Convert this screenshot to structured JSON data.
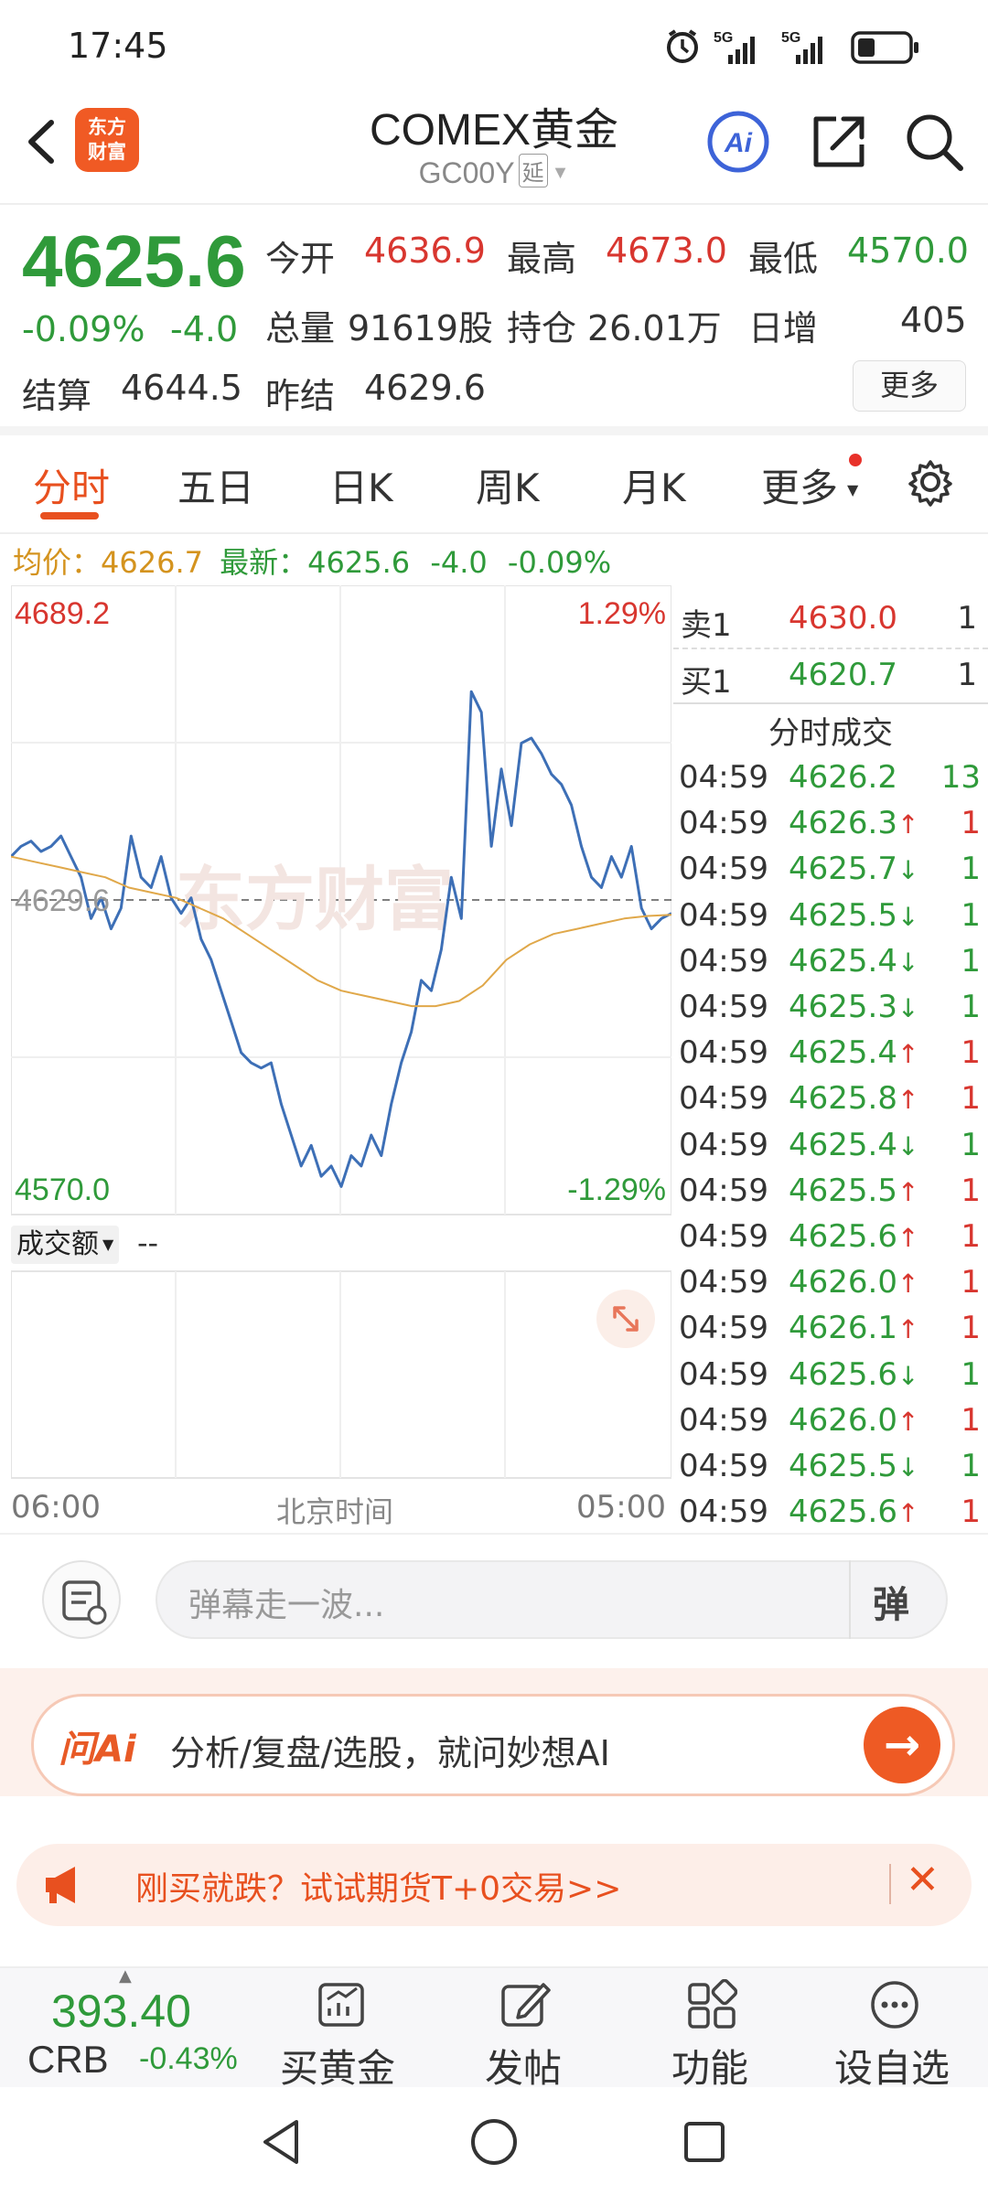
{
  "status_bar": {
    "time": "17:45",
    "signal1": "5G",
    "signal2": "5G",
    "icons": [
      "alarm-icon",
      "signal-icon",
      "signal-icon",
      "battery-icon"
    ]
  },
  "header": {
    "title": "COMEX黄金",
    "code": "GC00Y",
    "delay_tag": "延",
    "logo_text_1": "东方",
    "logo_text_2": "财富",
    "ai_label": "Ai"
  },
  "quote": {
    "last_price": "4625.6",
    "change_pct": "-0.09%",
    "change": "-4.0",
    "open_label": "今开",
    "open": "4636.9",
    "high_label": "最高",
    "high": "4673.0",
    "low_label": "最低",
    "low": "4570.0",
    "volume_label": "总量",
    "volume": "91619股",
    "oi_label": "持仓",
    "oi": "26.01万",
    "daily_inc_label": "日增",
    "daily_inc": "405",
    "settle_label": "结算",
    "settle": "4644.5",
    "prev_settle_label": "昨结",
    "prev_settle": "4629.6",
    "more": "更多"
  },
  "tabs": [
    {
      "label": "分时",
      "active": true
    },
    {
      "label": "五日"
    },
    {
      "label": "日K"
    },
    {
      "label": "周K"
    },
    {
      "label": "月K"
    },
    {
      "label": "更多"
    }
  ],
  "avg_row": {
    "avg_label": "均价：",
    "avg": "4626.7",
    "latest_label": "最新：",
    "latest": "4625.6",
    "latest_chg": "-4.0",
    "latest_pct": "-0.09%"
  },
  "chart": {
    "y_top": "4689.2",
    "y_mid": "4629.6",
    "y_bottom": "4570.0",
    "pct_top": "1.29%",
    "pct_bottom": "-1.29%",
    "watermark": "东方财富",
    "volume_label": "成交额",
    "volume_value": "--",
    "x_start": "06:00",
    "x_mid": "北京时间",
    "x_end": "05:00",
    "price_color": "#3d6fb6",
    "avg_color": "#e0a84a"
  },
  "chart_data": {
    "type": "line",
    "title": "",
    "xlabel": "北京时间",
    "ylabel": "",
    "ylim": [
      4570.0,
      4689.2
    ],
    "reference_line": 4629.6,
    "series": [
      {
        "values": [
          4638,
          4640,
          4641,
          4639,
          4640,
          4642,
          4638,
          4634,
          4626,
          4630,
          4624,
          4628,
          4642,
          4634,
          4632,
          4638,
          4630,
          4627,
          4630,
          4622,
          4618,
          4612,
          4606,
          4600,
          4598,
          4597,
          4598,
          4590,
          4584,
          4578,
          4582,
          4576,
          4578,
          4574,
          4580,
          4578,
          4584,
          4580,
          4590,
          4598,
          4604,
          4614,
          4612,
          4620,
          4634,
          4626,
          4670,
          4666,
          4640,
          4655,
          4644,
          4660,
          4661,
          4658,
          4654,
          4652,
          4648,
          4640,
          4634,
          4632,
          4638,
          4634,
          4640,
          4628,
          4624,
          4626,
          4627
        ]
      },
      {
        "values": [
          4638,
          4637,
          4636,
          4635,
          4634,
          4632,
          4631,
          4630,
          4628,
          4626,
          4623,
          4620,
          4617,
          4614,
          4612,
          4611,
          4610,
          4609,
          4609,
          4610,
          4613,
          4618,
          4621,
          4623,
          4624,
          4625,
          4626,
          4626.5,
          4626.7
        ]
      }
    ]
  },
  "order_book": {
    "ask_label": "卖1",
    "ask_price": "4630.0",
    "ask_vol": "1",
    "bid_label": "买1",
    "bid_price": "4620.7",
    "bid_vol": "1",
    "trades_title": "分时成交"
  },
  "trades": [
    {
      "time": "04:59",
      "price": "4626.2",
      "arrow": "",
      "vol": "13",
      "dir": "none"
    },
    {
      "time": "04:59",
      "price": "4626.3",
      "arrow": "↑",
      "vol": "1",
      "dir": "up"
    },
    {
      "time": "04:59",
      "price": "4625.7",
      "arrow": "↓",
      "vol": "1",
      "dir": "down"
    },
    {
      "time": "04:59",
      "price": "4625.5",
      "arrow": "↓",
      "vol": "1",
      "dir": "down"
    },
    {
      "time": "04:59",
      "price": "4625.4",
      "arrow": "↓",
      "vol": "1",
      "dir": "down"
    },
    {
      "time": "04:59",
      "price": "4625.3",
      "arrow": "↓",
      "vol": "1",
      "dir": "down"
    },
    {
      "time": "04:59",
      "price": "4625.4",
      "arrow": "↑",
      "vol": "1",
      "dir": "up"
    },
    {
      "time": "04:59",
      "price": "4625.8",
      "arrow": "↑",
      "vol": "1",
      "dir": "up"
    },
    {
      "time": "04:59",
      "price": "4625.4",
      "arrow": "↓",
      "vol": "1",
      "dir": "down"
    },
    {
      "time": "04:59",
      "price": "4625.5",
      "arrow": "↑",
      "vol": "1",
      "dir": "up"
    },
    {
      "time": "04:59",
      "price": "4625.6",
      "arrow": "↑",
      "vol": "1",
      "dir": "up"
    },
    {
      "time": "04:59",
      "price": "4626.0",
      "arrow": "↑",
      "vol": "1",
      "dir": "up"
    },
    {
      "time": "04:59",
      "price": "4626.1",
      "arrow": "↑",
      "vol": "1",
      "dir": "up"
    },
    {
      "time": "04:59",
      "price": "4625.6",
      "arrow": "↓",
      "vol": "1",
      "dir": "down"
    },
    {
      "time": "04:59",
      "price": "4626.0",
      "arrow": "↑",
      "vol": "1",
      "dir": "up"
    },
    {
      "time": "04:59",
      "price": "4625.5",
      "arrow": "↓",
      "vol": "1",
      "dir": "down"
    },
    {
      "time": "04:59",
      "price": "4625.6",
      "arrow": "↑",
      "vol": "1",
      "dir": "up"
    }
  ],
  "comment": {
    "placeholder": "弹幕走一波...",
    "send": "弹"
  },
  "ai_banner": {
    "logo": "问Ai",
    "text": "分析/复盘/选股，就问妙想AI"
  },
  "promo": {
    "text": "刚买就跌？试试期货T+0交易>>"
  },
  "bottom": {
    "crb_value": "393.40",
    "crb_name": "CRB",
    "crb_change": "-0.43%",
    "items": [
      {
        "label": "买黄金",
        "icon": "chart-buy-icon"
      },
      {
        "label": "发帖",
        "icon": "edit-icon"
      },
      {
        "label": "功能",
        "icon": "grid-icon"
      },
      {
        "label": "设自选",
        "icon": "more-icon"
      }
    ]
  },
  "colors": {
    "up": "#d8362f",
    "down": "#2f9a3a",
    "accent": "#e8501f"
  }
}
